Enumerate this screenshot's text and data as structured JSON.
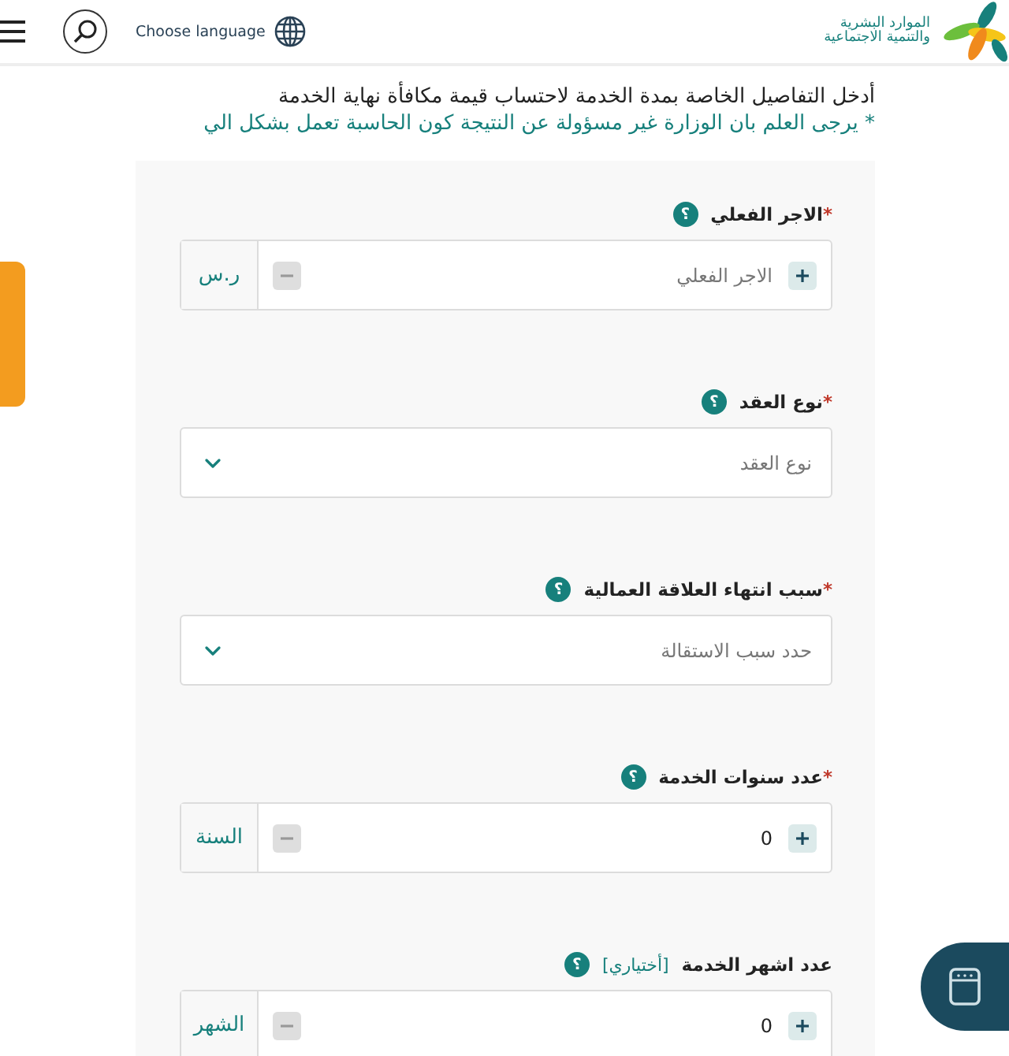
{
  "header": {
    "language_label": "Choose language"
  },
  "logo": {
    "line_1": "الموارد البشرية",
    "line_2": "والتنمية الاجتماعية"
  },
  "intro": {
    "title": "أدخل التفاصيل الخاصة بمدة الخدمة لاحتساب قيمة مكافأة نهاية الخدمة",
    "note": "* يرجى العلم بان الوزارة غير مسؤولة عن النتيجة كون الحاسبة تعمل بشكل الي"
  },
  "fields": [
    {
      "kind": "number",
      "marker": "*",
      "label": "الاجر الفعلي",
      "help": "؟",
      "placeholder": "الاجر الفعلي",
      "unit": "ر.س"
    },
    {
      "kind": "select",
      "marker": "*",
      "label": "نوع العقد",
      "help": "؟",
      "placeholder": "نوع العقد"
    },
    {
      "kind": "select",
      "marker": "*",
      "label": "سبب انتهاء العلاقة العمالية",
      "help": "؟",
      "placeholder": "حدد سبب الاستقالة"
    },
    {
      "kind": "number",
      "marker": "*",
      "label": "عدد سنوات الخدمة",
      "help": "؟",
      "value": "0",
      "unit": "السنة"
    },
    {
      "kind": "number",
      "label": "عدد اشهر الخدمة",
      "optional_tag": "[أختياري]",
      "help": "؟",
      "value": "0",
      "unit": "الشهر"
    }
  ]
}
